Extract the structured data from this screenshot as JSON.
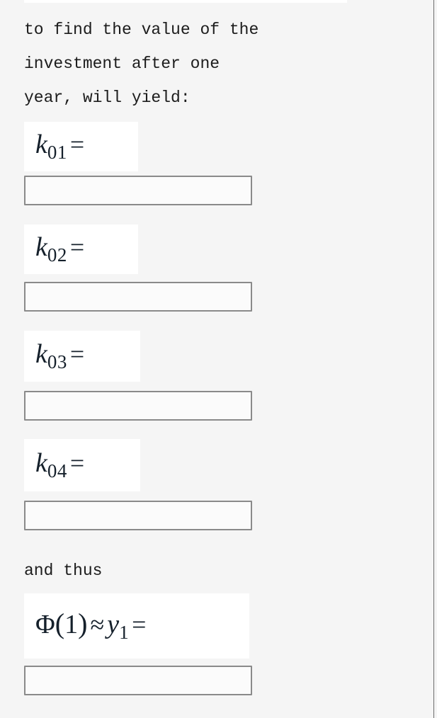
{
  "page": {
    "background_color": "#f5f5f5",
    "math_patch_color": "#ffffff",
    "text_color": "#1c1c1c",
    "math_color": "#15202b",
    "input_border_color": "#8a8a8a"
  },
  "paragraphs": {
    "intro_line_1": "to find the value of the",
    "intro_line_2": "investment after one",
    "intro_line_3": "year, will yield:",
    "and_thus": "and thus"
  },
  "formulas": [
    {
      "id": "k01",
      "latex": "k_{01} =",
      "plain": "k01 =",
      "var": "k",
      "subscript": "01",
      "operator": "="
    },
    {
      "id": "k02",
      "latex": "k_{02} =",
      "plain": "k02 =",
      "var": "k",
      "subscript": "02",
      "operator": "="
    },
    {
      "id": "k03",
      "latex": "k_{03} =",
      "plain": "k03 =",
      "var": "k",
      "subscript": "03",
      "operator": "="
    },
    {
      "id": "k04",
      "latex": "k_{04} =",
      "plain": "k04 =",
      "var": "k",
      "subscript": "04",
      "operator": "="
    }
  ],
  "final_formula": {
    "id": "phi1",
    "latex": "\\Phi(1) \\approx y_1 =",
    "plain": "Φ(1) ≈ y1 =",
    "phi": "Φ",
    "open_paren": "(",
    "arg": "1",
    "close_paren": ")",
    "approx": "≈",
    "var": "y",
    "subscript": "1",
    "operator": "="
  },
  "inputs": [
    {
      "id": "answer-k01",
      "value": "",
      "placeholder": ""
    },
    {
      "id": "answer-k02",
      "value": "",
      "placeholder": ""
    },
    {
      "id": "answer-k03",
      "value": "",
      "placeholder": ""
    },
    {
      "id": "answer-k04",
      "value": "",
      "placeholder": ""
    },
    {
      "id": "answer-phi1",
      "value": "",
      "placeholder": ""
    }
  ]
}
